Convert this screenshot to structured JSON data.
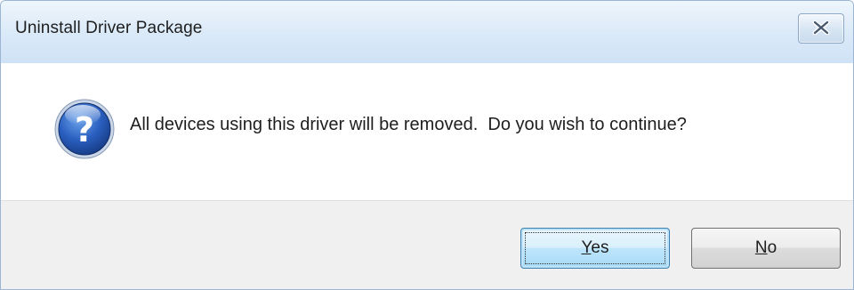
{
  "window": {
    "title": "Uninstall Driver Package",
    "close_icon": "close-icon"
  },
  "dialog": {
    "icon": "question-icon",
    "message": "All devices using this driver will be removed.  Do you wish to continue?"
  },
  "buttons": {
    "yes": {
      "mnemonic": "Y",
      "rest": "es"
    },
    "no": {
      "mnemonic": "N",
      "rest": "o"
    }
  },
  "colors": {
    "titlebar": "#dae9f8",
    "footer": "#f0f0f0",
    "icon_blue": "#1f4fa8"
  }
}
